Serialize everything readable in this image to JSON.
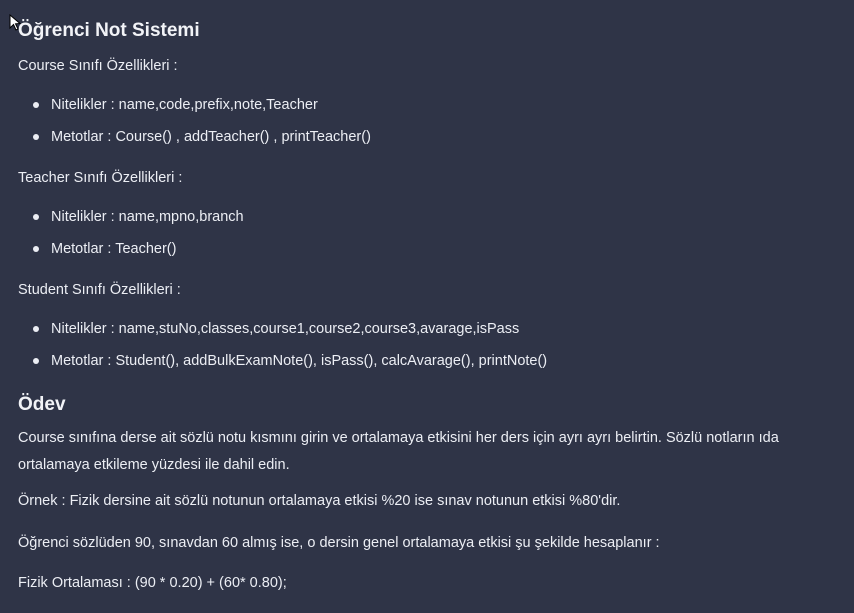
{
  "title": "Öğrenci Not Sistemi",
  "course": {
    "heading": "Course Sınıfı Özellikleri :",
    "items": [
      "Nitelikler : name,code,prefix,note,Teacher",
      "Metotlar : Course() , addTeacher() , printTeacher()"
    ]
  },
  "teacher": {
    "heading": "Teacher Sınıfı Özellikleri :",
    "items": [
      "Nitelikler : name,mpno,branch",
      "Metotlar : Teacher()"
    ]
  },
  "student": {
    "heading": "Student Sınıfı Özellikleri :",
    "items": [
      "Nitelikler : name,stuNo,classes,course1,course2,course3,avarage,isPass",
      "Metotlar : Student(), addBulkExamNote(), isPass(), calcAvarage(), printNote()"
    ]
  },
  "odev": {
    "heading": "Ödev",
    "para1": "Course sınıfına derse ait sözlü notu kısmını girin ve ortalamaya etkisini her ders için ayrı ayrı belirtin. Sözlü notların ıda ortalamaya etkileme yüzdesi ile dahil edin.",
    "para2": "Örnek : Fizik dersine ait sözlü notunun ortalamaya etkisi %20 ise sınav notunun etkisi %80'dir.",
    "para3": "Öğrenci sözlüden 90, sınavdan 60 almış ise, o dersin genel ortalamaya etkisi şu şekilde hesaplanır :",
    "para4": "Fizik Ortalaması : (90 * 0.20) + (60* 0.80);"
  },
  "icons": {
    "cursor": "mouse-pointer-icon"
  }
}
